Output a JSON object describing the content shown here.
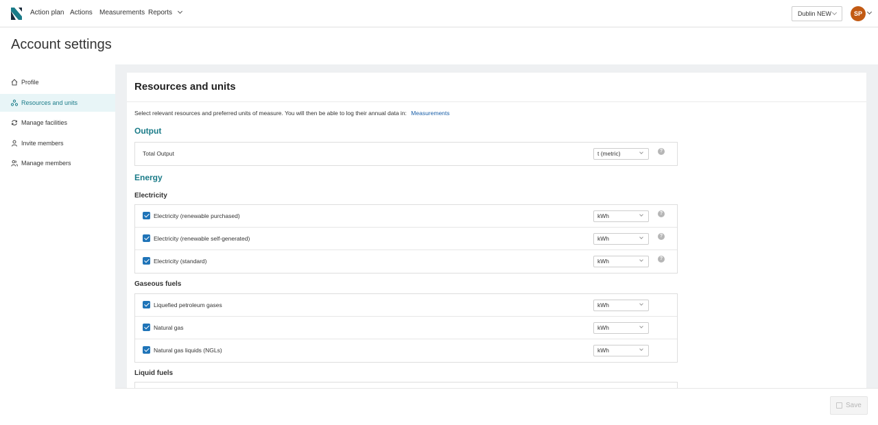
{
  "nav": {
    "items": [
      "Action plan",
      "Actions",
      "Measurements",
      "Reports"
    ],
    "site_select": "Dublin NEW",
    "avatar_initials": "SP"
  },
  "page_title": "Account settings",
  "sidebar": {
    "items": [
      {
        "label": "Profile",
        "icon": "home-icon"
      },
      {
        "label": "Resources and units",
        "icon": "resources-icon",
        "active": true
      },
      {
        "label": "Manage facilities",
        "icon": "refresh-icon"
      },
      {
        "label": "Invite members",
        "icon": "user-icon"
      },
      {
        "label": "Manage members",
        "icon": "users-icon"
      }
    ]
  },
  "card": {
    "title": "Resources and units",
    "intro": "Select relevant resources and preferred units of measure. You will then be able to log their annual data in:",
    "intro_link": "Measurements"
  },
  "sections": {
    "output": {
      "title": "Output",
      "rows": [
        {
          "label": "Total Output",
          "unit": "t (metric)"
        }
      ]
    },
    "energy": {
      "title": "Energy",
      "electricity": {
        "title": "Electricity",
        "rows": [
          {
            "label": "Electricity (renewable purchased)",
            "unit": "kWh",
            "checked": true
          },
          {
            "label": "Electricity (renewable self-generated)",
            "unit": "kWh",
            "checked": true
          },
          {
            "label": "Electricity (standard)",
            "unit": "kWh",
            "checked": true
          }
        ]
      },
      "gaseous": {
        "title": "Gaseous fuels",
        "rows": [
          {
            "label": "Liquefied petroleum gases",
            "unit": "kWh",
            "checked": true
          },
          {
            "label": "Natural gas",
            "unit": "kWh",
            "checked": true
          },
          {
            "label": "Natural gas liquids (NGLs)",
            "unit": "kWh",
            "checked": true
          }
        ]
      },
      "liquid": {
        "title": "Liquid fuels"
      }
    }
  },
  "footer": {
    "save_label": "Save"
  },
  "colors": {
    "accent": "#1a7b88",
    "checkbox": "#1f74b8",
    "avatar": "#c25a13"
  }
}
